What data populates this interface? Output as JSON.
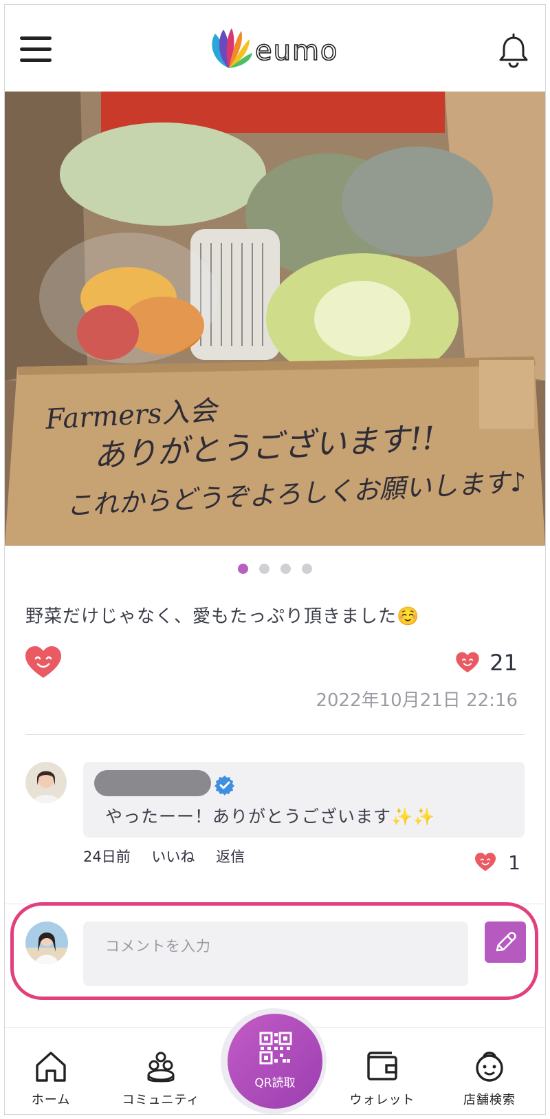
{
  "header": {
    "logo_text": "eumo",
    "menu_icon": "hamburger-menu-icon",
    "notification_icon": "bell-icon"
  },
  "post": {
    "photo_text_line1": "Farmers入会",
    "photo_text_line2": "ありがとうございます!!",
    "photo_text_line3": "これからどうぞよろしくお願いします♪",
    "image_count": 4,
    "active_image": 1,
    "caption": "野菜だけじゃなく、愛もたっぷり頂きました☺️",
    "like_count": "21",
    "timestamp": "2022年10月21日 22:16"
  },
  "comment": {
    "text": "やったーー！ありがとうございます✨✨",
    "age": "24日前",
    "like_label": "いいね",
    "reply_label": "返信",
    "like_count": "1"
  },
  "comment_input": {
    "placeholder": "コメントを入力"
  },
  "nav": {
    "home": "ホーム",
    "community": "コミュニティ",
    "qr": "QR読取",
    "wallet": "ウォレット",
    "shop_search": "店舗検索"
  },
  "colors": {
    "accent": "#b85fc2",
    "heart": "#e8545f",
    "highlight": "#e23f7d"
  }
}
